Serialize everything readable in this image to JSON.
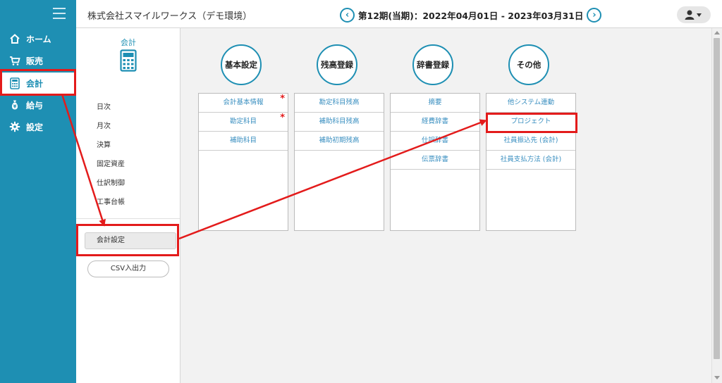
{
  "nav": {
    "items": [
      {
        "label": "ホーム",
        "icon": "home-icon"
      },
      {
        "label": "販売",
        "icon": "cart-icon"
      },
      {
        "label": "会計",
        "icon": "calculator-icon",
        "active": true
      },
      {
        "label": "給与",
        "icon": "moneybag-icon"
      },
      {
        "label": "設定",
        "icon": "gear-icon"
      }
    ]
  },
  "header": {
    "company": "株式会社スマイルワークス（デモ環境）",
    "period": "第12期(当期)：2022年04月01日 - 2023年03月31日",
    "prev_symbol": "‹",
    "next_symbol": "›"
  },
  "subpanel": {
    "title": "会計",
    "menu": [
      "日次",
      "月次",
      "決算",
      "固定資産",
      "仕訳制御",
      "工事台帳"
    ],
    "settings_button": "会計設定",
    "csv_button": "CSV入出力"
  },
  "columns": [
    {
      "title": "基本設定",
      "items": [
        {
          "label": "会計基本情報",
          "star": "*"
        },
        {
          "label": "勘定科目",
          "star": "*"
        },
        {
          "label": "補助科目",
          "star": ""
        }
      ]
    },
    {
      "title": "残高登録",
      "items": [
        {
          "label": "勘定科目残高",
          "star": ""
        },
        {
          "label": "補助科目残高",
          "star": ""
        },
        {
          "label": "補助初期残高",
          "star": ""
        }
      ]
    },
    {
      "title": "辞書登録",
      "items": [
        {
          "label": "摘要",
          "star": ""
        },
        {
          "label": "経費辞書",
          "star": ""
        },
        {
          "label": "仕訳辞書",
          "star": ""
        },
        {
          "label": "伝票辞書",
          "star": ""
        }
      ]
    },
    {
      "title": "その他",
      "items": [
        {
          "label": "他システム連動",
          "star": ""
        },
        {
          "label": "プロジェクト",
          "star": ""
        },
        {
          "label": "社員振込先 (会計)",
          "star": ""
        },
        {
          "label": "社員支払方法 (会計)",
          "star": ""
        }
      ]
    }
  ],
  "colors": {
    "accent": "#1e8fb3",
    "annotation": "#e31b1b",
    "link": "#3a8fc0"
  }
}
